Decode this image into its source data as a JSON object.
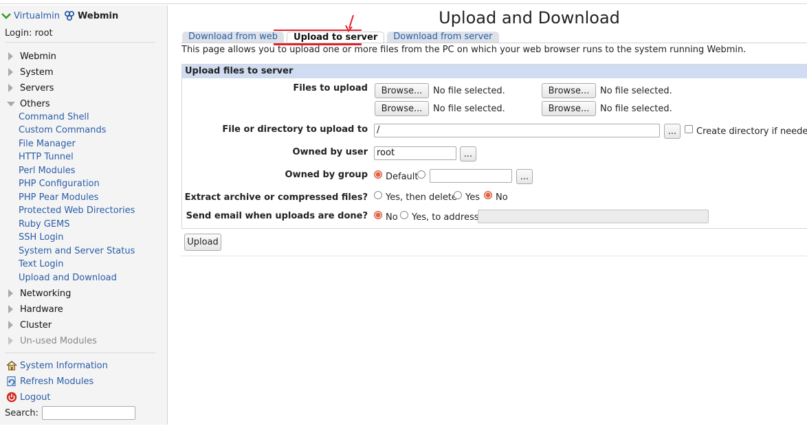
{
  "sidebar": {
    "virtualmin_label": "Virtualmin",
    "webmin_label": "Webmin",
    "login": "Login: root",
    "categories_top": [
      {
        "label": "Webmin"
      },
      {
        "label": "System"
      },
      {
        "label": "Servers"
      }
    ],
    "others": {
      "label": "Others",
      "items": [
        "Command Shell",
        "Custom Commands",
        "File Manager",
        "HTTP Tunnel",
        "Perl Modules",
        "PHP Configuration",
        "PHP Pear Modules",
        "Protected Web Directories",
        "Ruby GEMS",
        "SSH Login",
        "System and Server Status",
        "Text Login",
        "Upload and Download"
      ]
    },
    "categories_bottom": [
      {
        "label": "Networking"
      },
      {
        "label": "Hardware"
      },
      {
        "label": "Cluster"
      },
      {
        "label": "Un-used Modules"
      }
    ],
    "links": {
      "system_information": "System Information",
      "refresh_modules": "Refresh Modules",
      "logout": "Logout"
    },
    "search_label": "Search:"
  },
  "page": {
    "title": "Upload and Download",
    "tabs": [
      "Download from web",
      "Upload to server",
      "Download from server"
    ],
    "active_tab": "Upload to server",
    "intro": "This page allows you to upload one or more files from the PC on which your web browser runs to the system running Webmin."
  },
  "form": {
    "section_title": "Upload files to server",
    "files_label": "Files to upload",
    "browse_label": "Browse...",
    "no_file": "No file selected.",
    "dest_label": "File or directory to upload to",
    "dest_value": "/",
    "ellipsis": "...",
    "create_dir_label": "Create directory if needed?",
    "user_label": "Owned by user",
    "user_value": "root",
    "group_label": "Owned by group",
    "group_default": "Default",
    "extract_label": "Extract archive or compressed files?",
    "extract_options": [
      "Yes, then delete",
      "Yes",
      "No"
    ],
    "extract_selected": "No",
    "email_label": "Send email when uploads are done?",
    "email_options": [
      "No",
      "Yes, to address"
    ],
    "email_selected": "No",
    "submit_label": "Upload"
  },
  "colors": {
    "link": "#2a5da8",
    "section_header": "#cfdcf1",
    "annotation": "#e0202a"
  }
}
